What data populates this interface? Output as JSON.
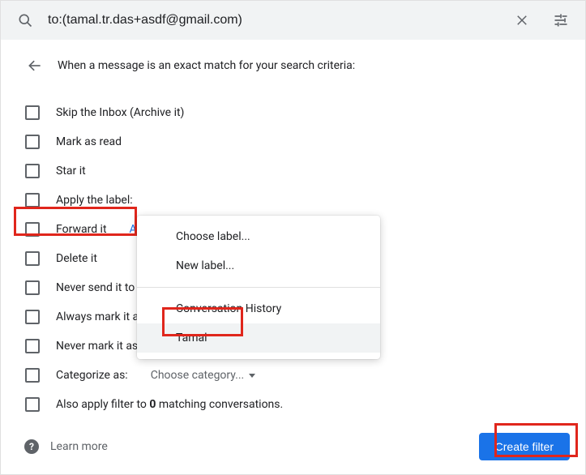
{
  "search": {
    "value": "to:(tamal.tr.das+asdf@gmail.com)"
  },
  "header": {
    "text": "When a message is an exact match for your search criteria:"
  },
  "options": {
    "skip_inbox": "Skip the Inbox (Archive it)",
    "mark_read": "Mark as read",
    "star_it": "Star it",
    "apply_label": "Apply the label:",
    "forward_it": "Forward it",
    "forward_link": "Add forwarding address",
    "delete_it": "Delete it",
    "never_spam": "Never send it to Spam",
    "always_important": "Always mark it as important",
    "never_important": "Never mark it as important",
    "categorize": "Categorize as:",
    "categorize_dropdown": "Choose category...",
    "also_apply_prefix": "Also apply filter to ",
    "also_apply_count": "0",
    "also_apply_suffix": " matching conversations."
  },
  "dropdown": {
    "choose": "Choose label...",
    "new_label": "New label...",
    "conversation_history": "Conversation History",
    "tamal": "Tamal"
  },
  "footer": {
    "learn_more": "Learn more",
    "create_filter": "Create filter"
  }
}
